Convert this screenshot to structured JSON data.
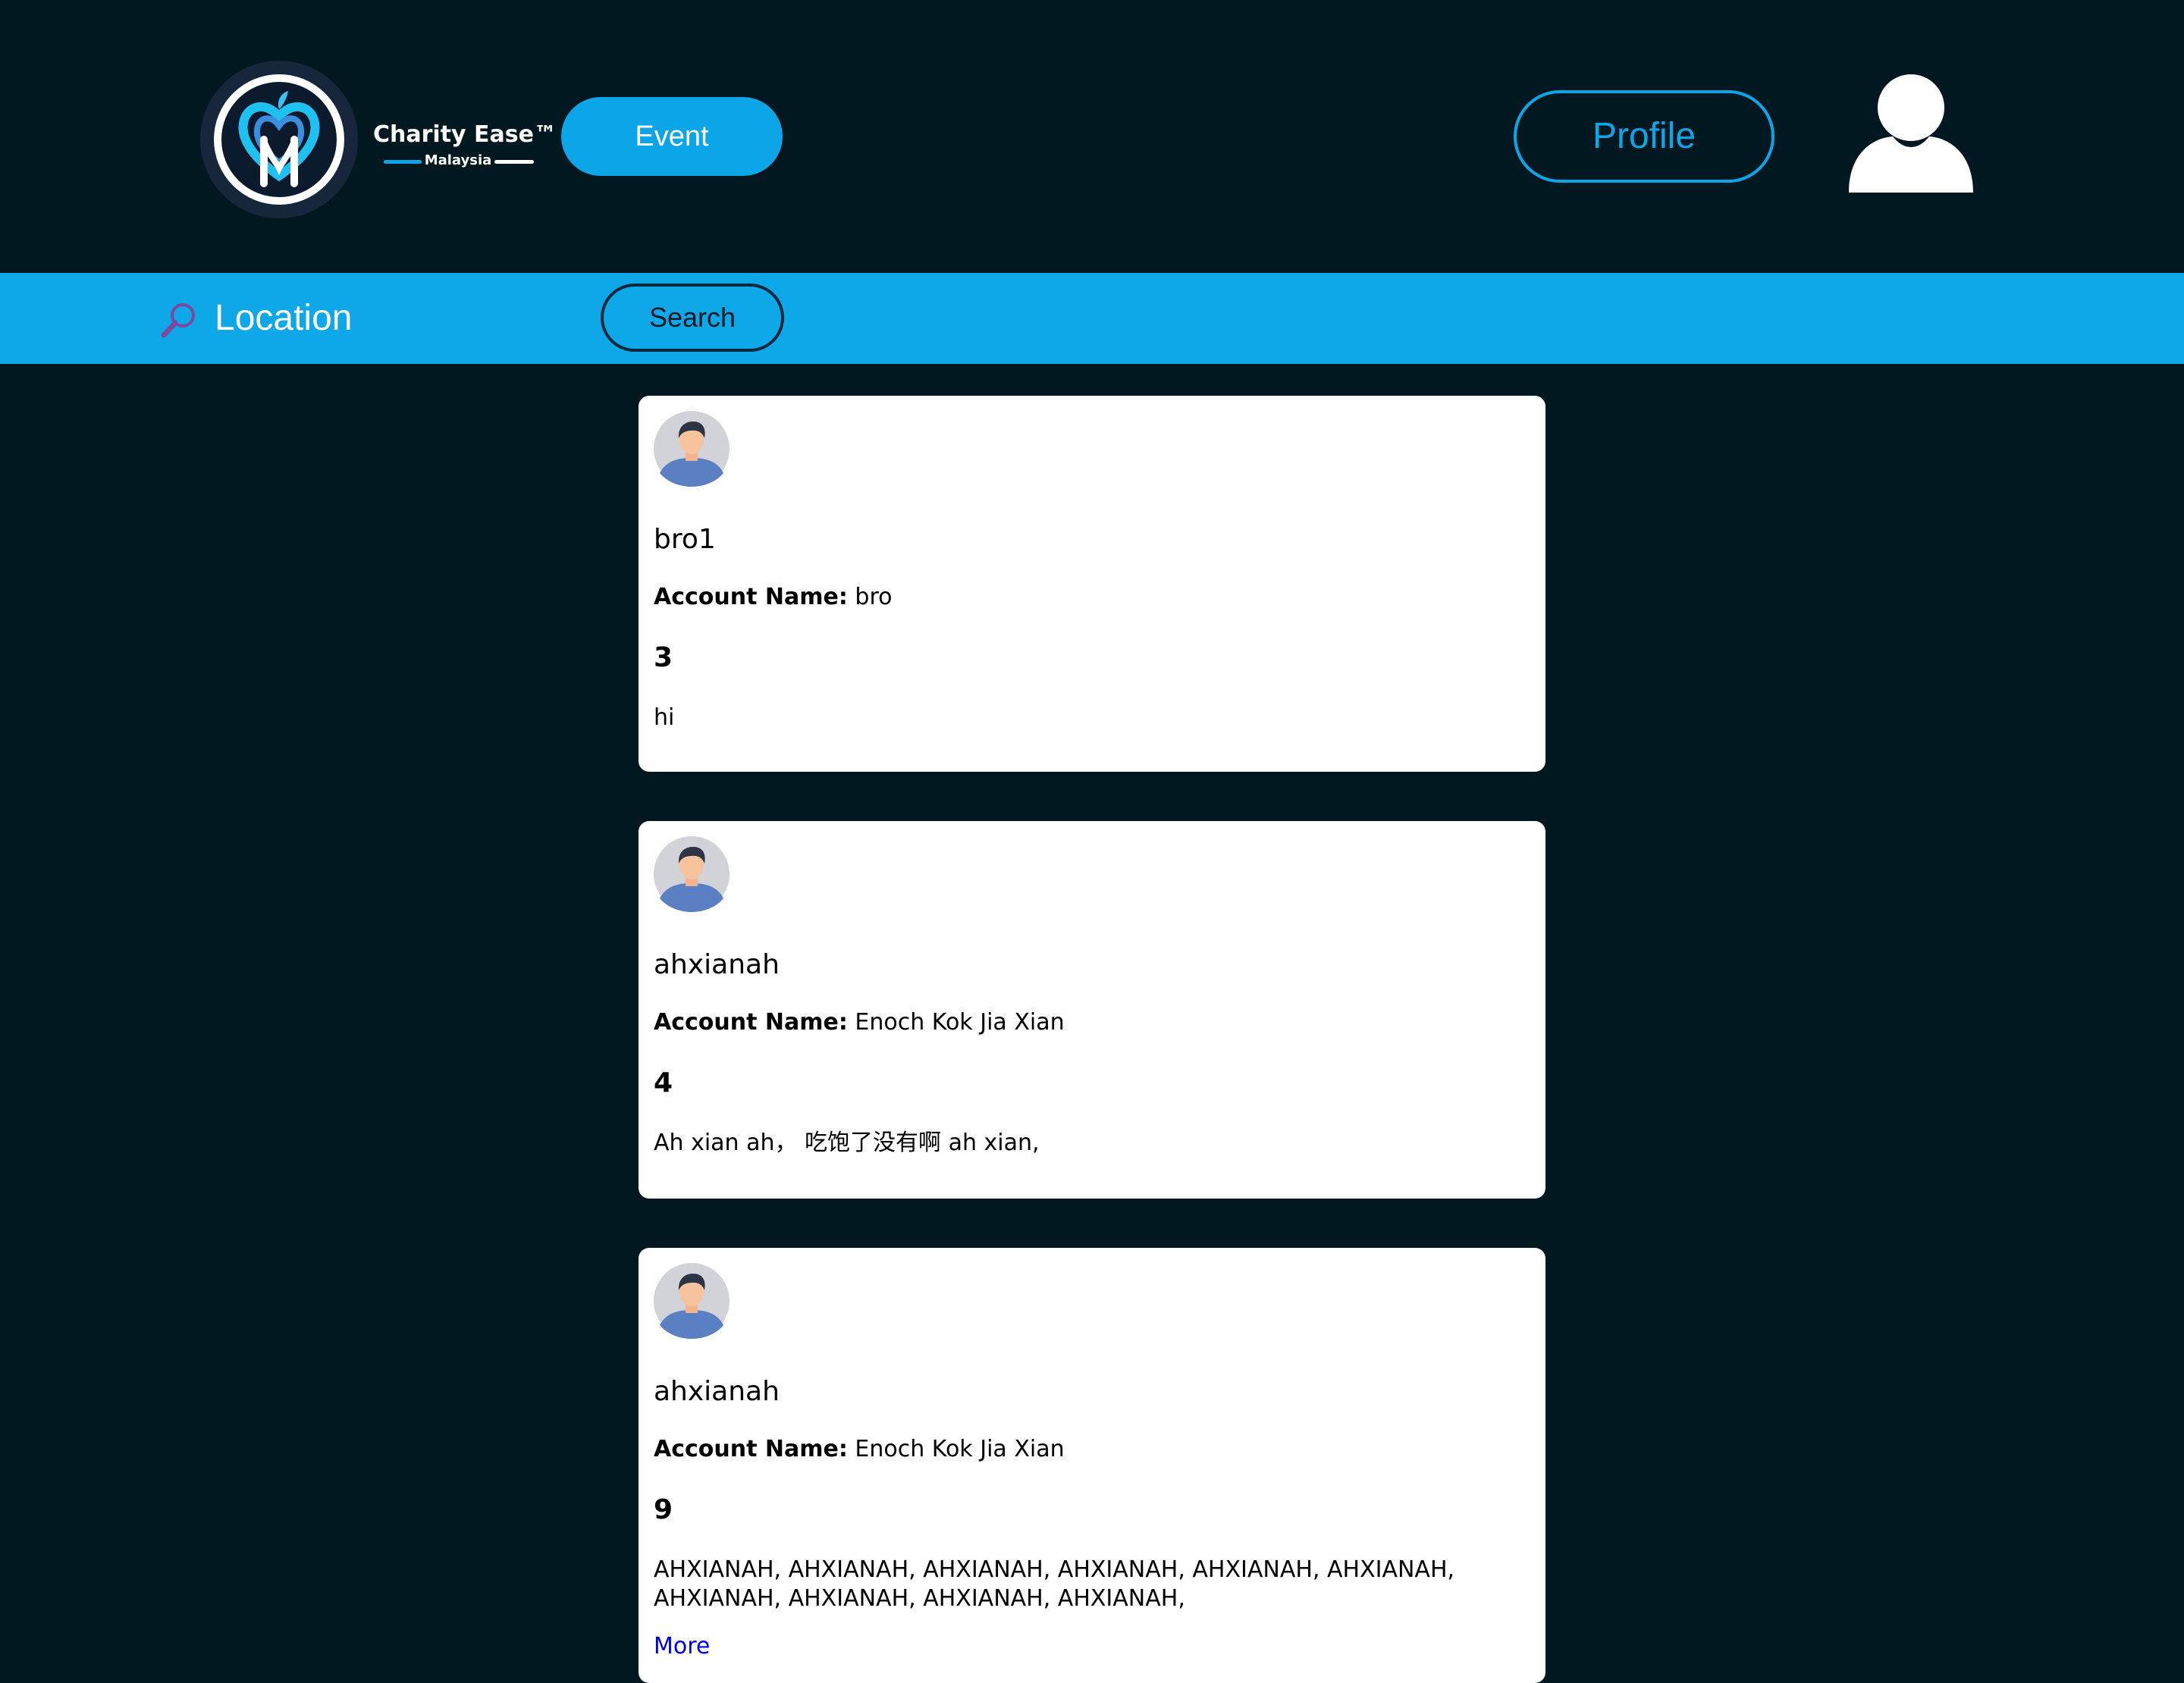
{
  "header": {
    "brand": {
      "name": "Charity Ease™",
      "subtitle": "Malaysia"
    },
    "event_button": "Event",
    "profile_button": "Profile"
  },
  "search": {
    "location_label": "Location",
    "search_button": "Search"
  },
  "posts": [
    {
      "username": "bro1",
      "account_label": "Account Name:",
      "account_name": "bro",
      "number": "3",
      "text": "hi"
    },
    {
      "username": "ahxianah",
      "account_label": "Account Name:",
      "account_name": "Enoch Kok Jia Xian",
      "number": "4",
      "text": "Ah xian ah，  吃饱了没有啊 ah xian,"
    },
    {
      "username": "ahxianah",
      "account_label": "Account Name:",
      "account_name": "Enoch Kok Jia Xian",
      "number": "9",
      "text": "AHXIANAH, AHXIANAH, AHXIANAH, AHXIANAH, AHXIANAH, AHXIANAH, AHXIANAH, AHXIANAH, AHXIANAH, AHXIANAH,",
      "more_link": "More"
    }
  ],
  "colors": {
    "background": "#011820",
    "accent": "#0ea7e7",
    "card": "#ffffff",
    "link": "#0000ee"
  }
}
